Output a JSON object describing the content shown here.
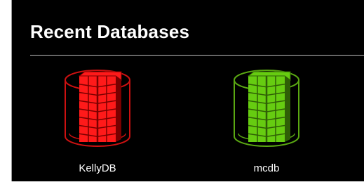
{
  "section": {
    "title": "Recent Databases"
  },
  "databases": [
    {
      "name": "KellyDB",
      "icon": "database-cylinder-icon",
      "color": "#ff1a1a",
      "outline": "#cc1111",
      "dark": "#7a0000"
    },
    {
      "name": "mcdb",
      "icon": "database-cylinder-icon",
      "color": "#66cc11",
      "outline": "#5aa812",
      "dark": "#2f5f06"
    }
  ]
}
